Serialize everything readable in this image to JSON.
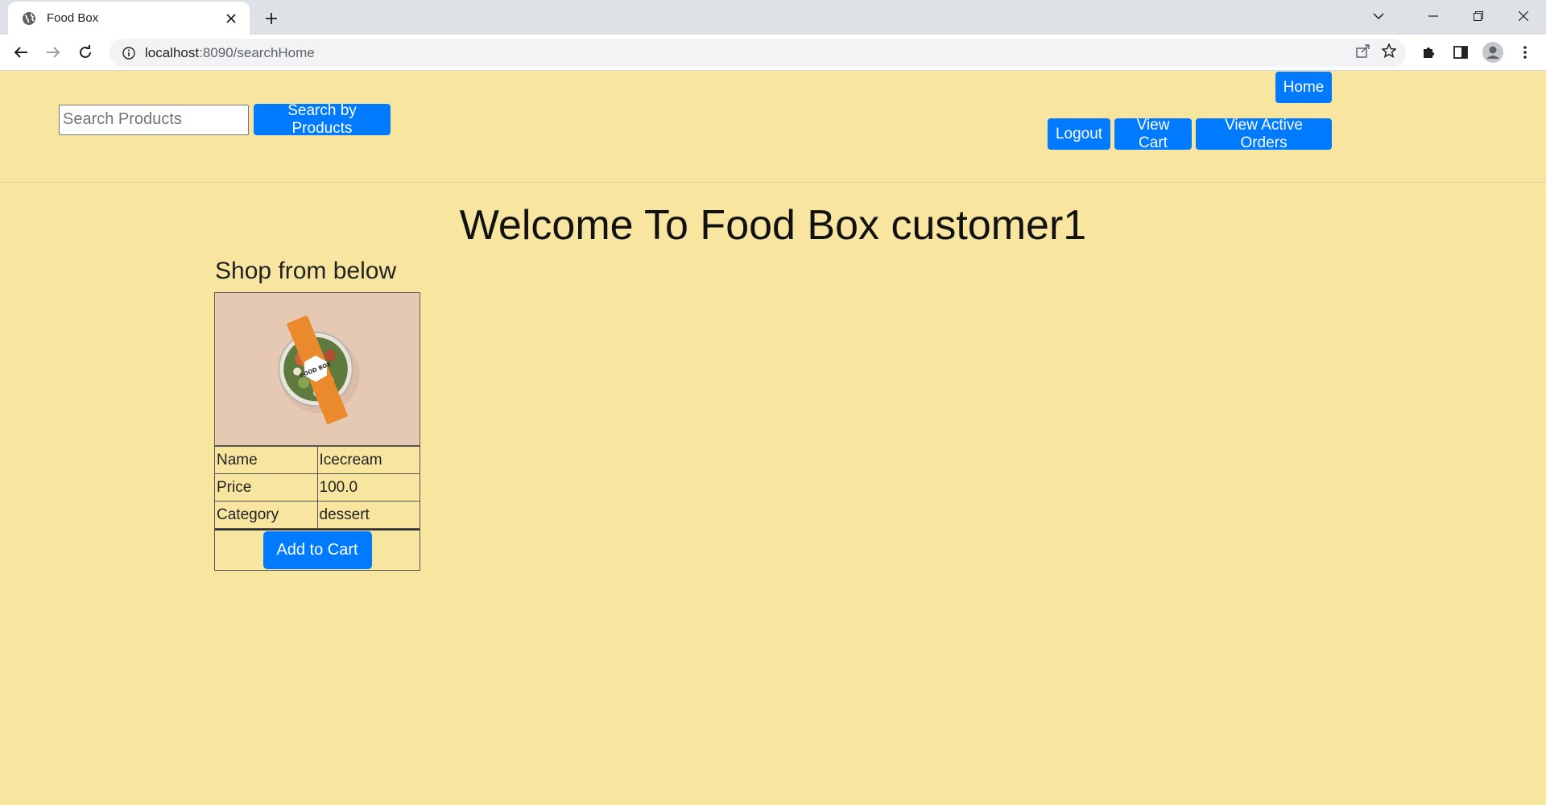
{
  "browser": {
    "tab_title": "Food Box",
    "url_host": "localhost",
    "url_rest": ":8090/searchHome"
  },
  "header": {
    "home_label": "Home",
    "search_placeholder": "Search Products",
    "search_button": "Search by Products",
    "logout_label": "Logout",
    "view_cart_label": "View Cart",
    "view_orders_label": "View Active Orders"
  },
  "main": {
    "welcome": "Welcome To Food Box customer1",
    "shop_heading": "Shop from below",
    "product": {
      "image_text": "FOOD BOX",
      "rows": [
        {
          "label": "Name",
          "value": "Icecream"
        },
        {
          "label": "Price",
          "value": "100.0"
        },
        {
          "label": "Category",
          "value": "dessert"
        }
      ],
      "add_to_cart": "Add to Cart"
    }
  },
  "colors": {
    "page_bg": "#f8e6a0",
    "button": "#007bff"
  }
}
